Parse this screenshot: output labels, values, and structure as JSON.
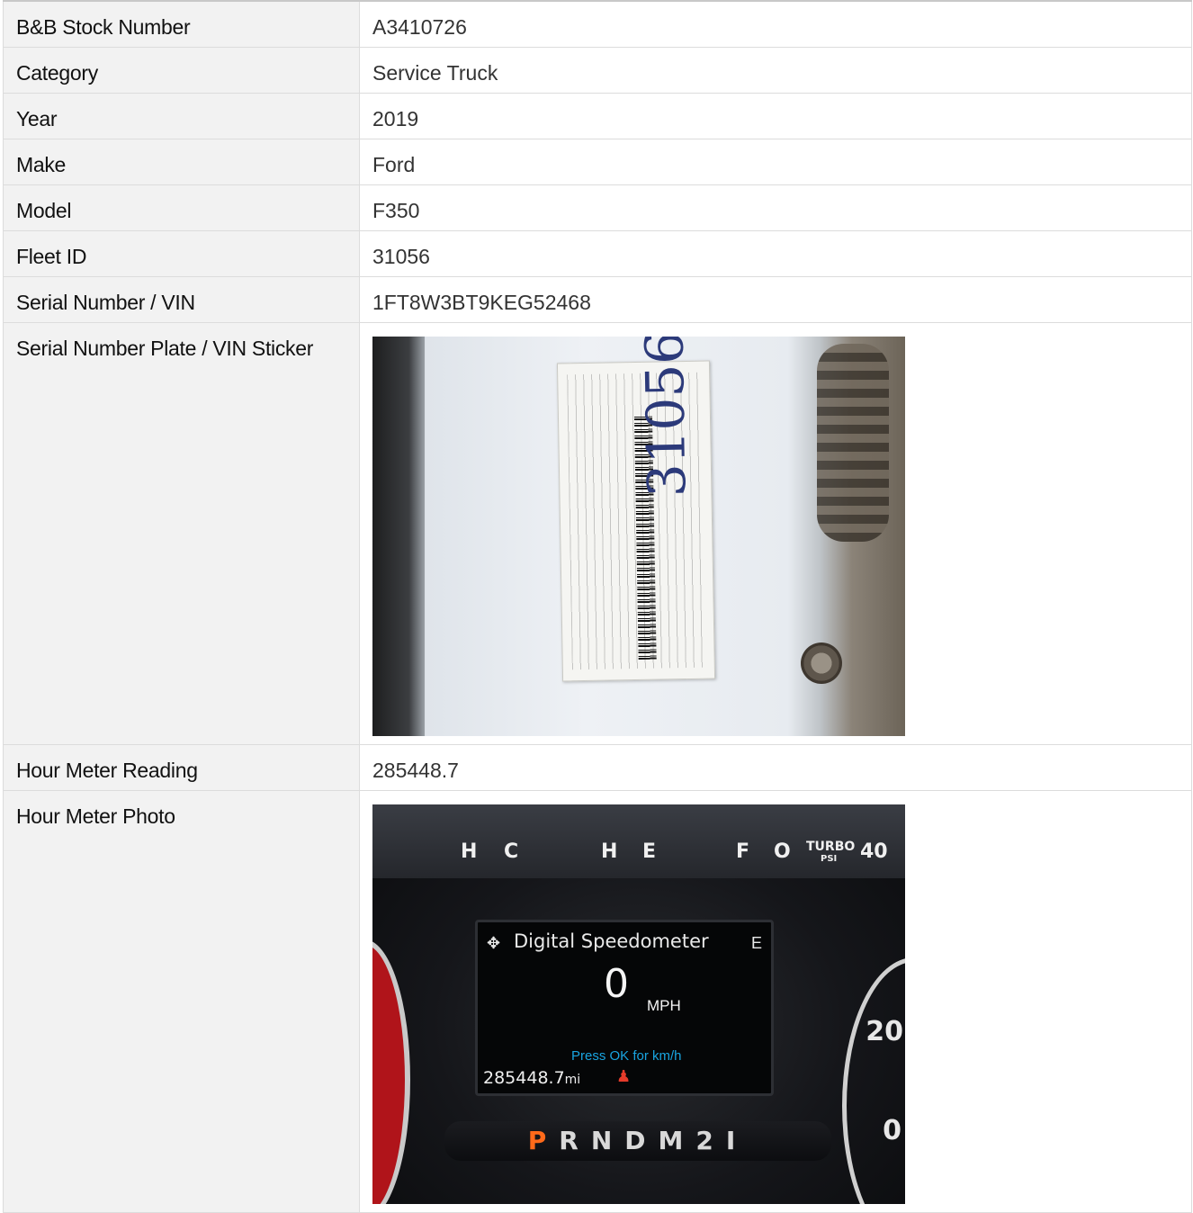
{
  "rows": [
    {
      "label": "B&B Stock Number",
      "value": "A3410726"
    },
    {
      "label": "Category",
      "value": "Service Truck"
    },
    {
      "label": "Year",
      "value": "2019"
    },
    {
      "label": "Make",
      "value": "Ford"
    },
    {
      "label": "Model",
      "value": "F350"
    },
    {
      "label": "Fleet ID",
      "value": "31056"
    },
    {
      "label": "Serial Number / VIN",
      "value": "1FT8W3BT9KEG52468"
    }
  ],
  "vin_sticker": {
    "label": "Serial Number Plate / VIN Sticker",
    "photo_text": {
      "handwritten": "31056"
    }
  },
  "hour_meter": {
    "label": "Hour Meter Reading",
    "value": "285448.7"
  },
  "hour_meter_photo": {
    "label": "Hour Meter Photo",
    "photo_text": {
      "gauges": [
        "H",
        "C",
        "H",
        "E",
        "F",
        "O",
        "TURBO",
        "PSI",
        "40"
      ],
      "title": "Digital Speedometer",
      "e": "E",
      "speed": "0",
      "speed_unit": "MPH",
      "hint": "Press OK for km/h",
      "odometer": "285448.7",
      "odometer_unit": "mi",
      "gear_p": "P",
      "gears_rest": "RNDM2I",
      "dial_numbers": [
        "20",
        "0"
      ]
    }
  }
}
